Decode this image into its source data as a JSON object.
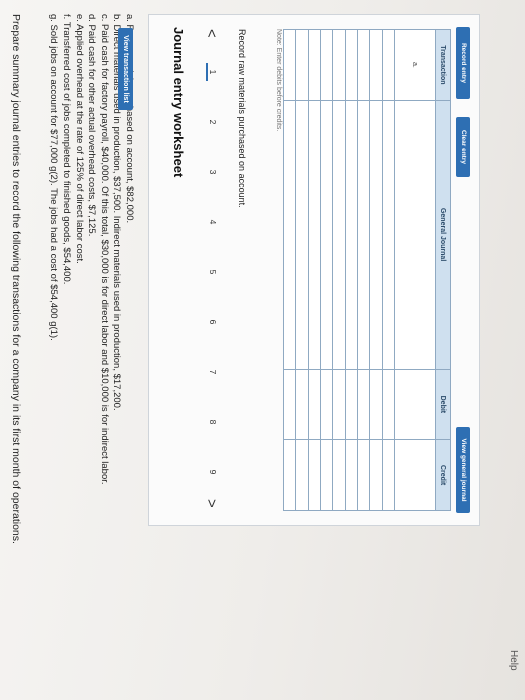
{
  "header": {
    "help_label": "Help"
  },
  "prompt": "Prepare summary journal entries to record the following transactions for a company in its first month of operations.",
  "transactions": [
    "a. Raw materials purchased on account, $82,000.",
    "b. Direct materials used in production, $37,500. Indirect materials used in production, $17,200.",
    "c. Paid cash for factory payroll, $40,000. Of this total, $30,000 is for direct labor and $10,000 is for indirect labor.",
    "d. Paid cash for other actual overhead costs, $7,125.",
    "e. Applied overhead at the rate of 125% of direct labor cost.",
    "f. Transferred cost of jobs completed to finished goods, $54,400.",
    "g. Sold jobs on account for $77,000 g(2). The jobs had a cost of $54,400 g(1)."
  ],
  "view_transaction_list_label": "View transaction list",
  "worksheet": {
    "title": "Journal entry worksheet",
    "prev_arrow": "<",
    "next_arrow": ">",
    "pages": [
      "1",
      "2",
      "3",
      "4",
      "5",
      "6",
      "7",
      "8",
      "9"
    ],
    "active_page": "1",
    "description": "Record raw materials purchased on account.",
    "note": "Note: Enter debits before credits.",
    "table": {
      "headers": [
        "Transaction",
        "General Journal",
        "Debit",
        "Credit"
      ],
      "first_transaction": "a."
    },
    "buttons": {
      "record": "Record entry",
      "clear": "Clear entry",
      "view_general": "View general journal"
    }
  }
}
